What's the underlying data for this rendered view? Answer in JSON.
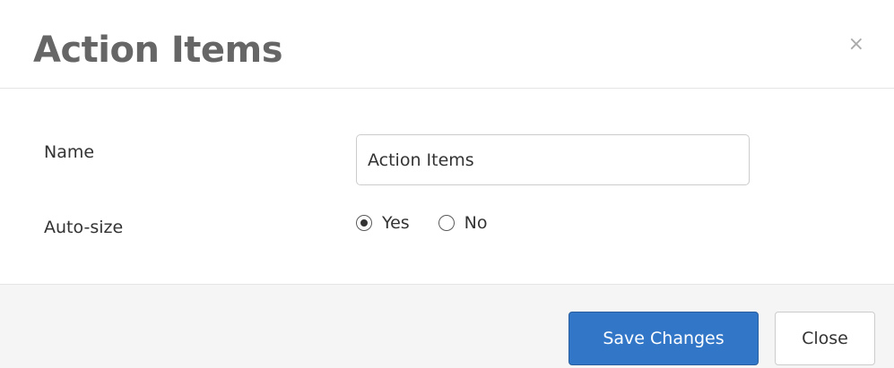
{
  "modal": {
    "title": "Action Items",
    "close_glyph": "×"
  },
  "form": {
    "name_label": "Name",
    "name_value": "Action Items",
    "autosize_label": "Auto-size",
    "autosize_options": [
      {
        "label": "Yes",
        "selected": true
      },
      {
        "label": "No",
        "selected": false
      }
    ]
  },
  "footer": {
    "save_label": "Save Changes",
    "close_label": "Close"
  },
  "colors": {
    "primary_button": "#3276c8",
    "footer_background": "#f5f5f5",
    "title_text": "#666666"
  },
  "icons": {
    "close": "close-icon",
    "radio_selected": "radio-checked-icon",
    "radio_unselected": "radio-unchecked-icon"
  }
}
